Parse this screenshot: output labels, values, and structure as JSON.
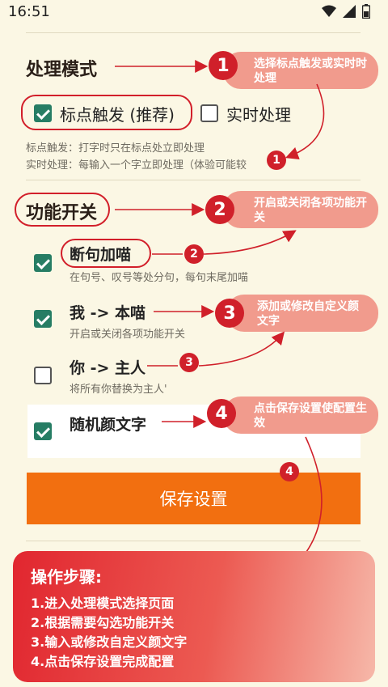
{
  "status_bar": {
    "time": "16:51",
    "icons": [
      "wifi-icon",
      "signal-icon",
      "battery-icon"
    ]
  },
  "mode_section": {
    "title": "处理模式",
    "options": [
      {
        "label": "标点触发 (推荐)",
        "checked": true
      },
      {
        "label": "实时处理",
        "checked": false
      }
    ],
    "desc_lines": [
      "标点触发：打字时只在标点处立即处理",
      "实时处理：每输入一个字立即处理（体验可能较"
    ]
  },
  "function_section": {
    "title": "功能开关",
    "items": [
      {
        "label": "断句加喵",
        "desc": "在句号、叹号等处分句，每句末尾加喵",
        "checked": true
      },
      {
        "label": "我 -> 本喵",
        "desc": "开启或关闭各项功能开关",
        "checked": true
      },
      {
        "label": "你 -> 主人",
        "desc": "将所有你替换为主人'",
        "checked": false
      },
      {
        "label": "随机颜文字",
        "desc": "",
        "checked": true
      }
    ]
  },
  "save_button": {
    "label": "保存设置"
  },
  "callouts": [
    {
      "num": "1",
      "text": "选择标点触发或实时时处理"
    },
    {
      "num": "2",
      "text": "开启或关闭各项功能开关"
    },
    {
      "num": "3",
      "text": "添加或修改自定义颜文字"
    },
    {
      "num": "4",
      "text": "点击保存设置使配置生效"
    }
  ],
  "small_markers": [
    "1",
    "2",
    "3",
    "4"
  ],
  "steps": {
    "title": "操作步骤:",
    "items": [
      "1.进入处理模式选择页面",
      "2.根据需要勾选功能开关",
      "3.输入或修改自定义颜文字",
      "4.点击保存设置完成配置"
    ]
  },
  "colors": {
    "accent_red": "#d0202a",
    "pill": "#f19b8d",
    "check_green": "#267d64",
    "save_orange": "#f26f10",
    "background": "#fbf7e4"
  }
}
